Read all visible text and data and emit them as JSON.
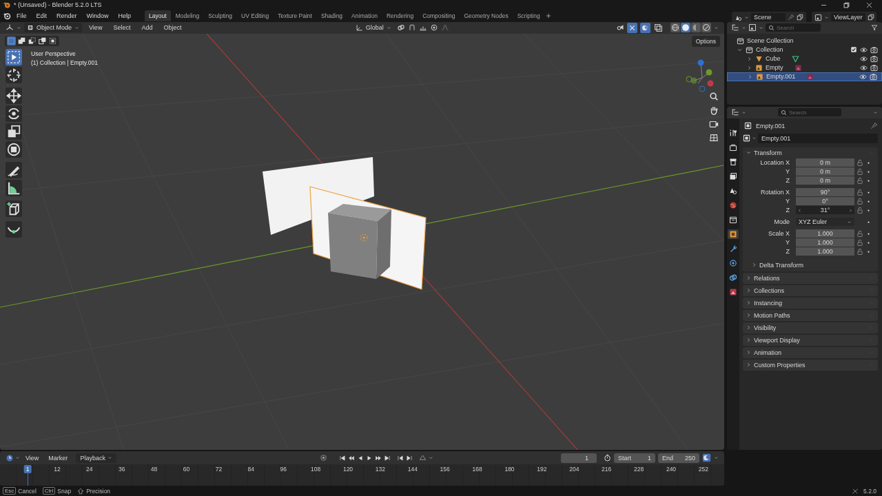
{
  "window": {
    "title": "* (Unsaved) - Blender 5.2.0 LTS"
  },
  "menu": [
    "File",
    "Edit",
    "Render",
    "Window",
    "Help"
  ],
  "workspaces": [
    {
      "label": "Layout",
      "selected": true
    },
    {
      "label": "Modeling",
      "selected": false
    },
    {
      "label": "Sculpting",
      "selected": false
    },
    {
      "label": "UV Editing",
      "selected": false
    },
    {
      "label": "Texture Paint",
      "selected": false
    },
    {
      "label": "Shading",
      "selected": false
    },
    {
      "label": "Animation",
      "selected": false
    },
    {
      "label": "Rendering",
      "selected": false
    },
    {
      "label": "Compositing",
      "selected": false
    },
    {
      "label": "Geometry Nodes",
      "selected": false
    },
    {
      "label": "Scripting",
      "selected": false
    }
  ],
  "scene_selector": {
    "scene": "Scene",
    "view_layer": "ViewLayer"
  },
  "viewport_header": {
    "mode": "Object Mode",
    "menus": [
      "View",
      "Select",
      "Add",
      "Object"
    ],
    "orientation": "Global",
    "toggles": [
      {
        "kind": "gizmo",
        "on": true
      },
      {
        "kind": "overlay",
        "on": true
      },
      {
        "kind": "xray",
        "on": false
      }
    ],
    "shading": [
      {
        "kind": "wireframe",
        "selected": false
      },
      {
        "kind": "solid",
        "selected": true
      },
      {
        "kind": "material",
        "selected": false
      },
      {
        "kind": "rendered",
        "selected": false
      }
    ]
  },
  "viewport": {
    "options": "Options",
    "overlay_lines": [
      "User Perspective",
      "(1) Collection | Empty.001"
    ],
    "select_modes": [
      {
        "kind": "new",
        "selected": true
      },
      {
        "kind": "extend",
        "selected": false
      },
      {
        "kind": "subtract",
        "selected": false
      },
      {
        "kind": "invert",
        "selected": false
      },
      {
        "kind": "intersect",
        "selected": false
      }
    ],
    "tools": [
      {
        "kind": "select",
        "selected": true
      },
      {
        "kind": "cursor",
        "selected": false
      },
      {
        "kind": "move",
        "selected": false
      },
      {
        "kind": "rotate",
        "selected": false
      },
      {
        "kind": "scale",
        "selected": false
      },
      {
        "kind": "transform",
        "selected": false
      },
      {
        "kind": "annotate",
        "selected": false
      },
      {
        "kind": "measure",
        "selected": false
      },
      {
        "kind": "add_cube",
        "selected": false
      },
      {
        "kind": "curve",
        "selected": false
      }
    ]
  },
  "outliner": {
    "search_placeholder": "Search",
    "root": "Scene Collection",
    "items": [
      {
        "label": "Collection",
        "kind": "collection",
        "expanded": true,
        "selected": false,
        "checked": true,
        "children": [
          {
            "label": "Cube",
            "kind": "mesh",
            "expanded": false,
            "selected": false
          },
          {
            "label": "Empty",
            "kind": "image_empty",
            "expanded": false,
            "selected": false
          },
          {
            "label": "Empty.001",
            "kind": "image_empty",
            "expanded": false,
            "selected": true
          }
        ]
      }
    ]
  },
  "properties": {
    "search_placeholder": "Search",
    "object_name": "Empty.001",
    "datablock": "Empty.001",
    "tabs": [
      {
        "kind": "tool",
        "selected": false
      },
      {
        "kind": "render",
        "selected": false
      },
      {
        "kind": "output",
        "selected": false
      },
      {
        "kind": "view_layer",
        "selected": false
      },
      {
        "kind": "scene",
        "selected": false
      },
      {
        "kind": "world",
        "selected": false
      },
      {
        "kind": "collection",
        "selected": false
      },
      {
        "kind": "object",
        "selected": true
      },
      {
        "kind": "modifiers",
        "selected": false
      },
      {
        "kind": "physics",
        "selected": false
      },
      {
        "kind": "constraints",
        "selected": false
      },
      {
        "kind": "data",
        "selected": false
      }
    ],
    "transform": {
      "title": "Transform",
      "expanded": true,
      "groups": [
        [
          {
            "label": "Location X",
            "value": "0 m",
            "kind": "number",
            "active": false
          },
          {
            "label": "Y",
            "value": "0 m",
            "kind": "number",
            "active": false
          },
          {
            "label": "Z",
            "value": "0 m",
            "kind": "number",
            "active": false
          }
        ],
        [
          {
            "label": "Rotation X",
            "value": "90°",
            "kind": "number",
            "active": false
          },
          {
            "label": "Y",
            "value": "0°",
            "kind": "number",
            "active": false
          },
          {
            "label": "Z",
            "value": "31°",
            "kind": "number",
            "active": true
          }
        ],
        [
          {
            "label": "Mode",
            "value": "XYZ Euler",
            "kind": "dropdown",
            "active": false
          }
        ],
        [
          {
            "label": "Scale X",
            "value": "1.000",
            "kind": "number",
            "active": false
          },
          {
            "label": "Y",
            "value": "1.000",
            "kind": "number",
            "active": false
          },
          {
            "label": "Z",
            "value": "1.000",
            "kind": "number",
            "active": false
          }
        ]
      ],
      "subpanels": [
        {
          "title": "Delta Transform",
          "expanded": false
        }
      ]
    },
    "panels": [
      {
        "title": "Relations",
        "expanded": false
      },
      {
        "title": "Collections",
        "expanded": false
      },
      {
        "title": "Instancing",
        "expanded": false
      },
      {
        "title": "Motion Paths",
        "expanded": false
      },
      {
        "title": "Visibility",
        "expanded": false
      },
      {
        "title": "Viewport Display",
        "expanded": false
      },
      {
        "title": "Animation",
        "expanded": false
      },
      {
        "title": "Custom Properties",
        "expanded": false
      }
    ]
  },
  "timeline": {
    "menus": [
      "View",
      "Marker",
      "Playback"
    ],
    "current_frame": "1",
    "start_label": "Start",
    "start": "1",
    "end_label": "End",
    "end": "250",
    "ruler": [
      {
        "label": "1",
        "selected": true
      },
      {
        "label": "12",
        "selected": false
      },
      {
        "label": "24",
        "selected": false
      },
      {
        "label": "36",
        "selected": false
      },
      {
        "label": "48",
        "selected": false
      },
      {
        "label": "60",
        "selected": false
      },
      {
        "label": "72",
        "selected": false
      },
      {
        "label": "84",
        "selected": false
      },
      {
        "label": "96",
        "selected": false
      },
      {
        "label": "108",
        "selected": false
      },
      {
        "label": "120",
        "selected": false
      },
      {
        "label": "132",
        "selected": false
      },
      {
        "label": "144",
        "selected": false
      },
      {
        "label": "156",
        "selected": false
      },
      {
        "label": "168",
        "selected": false
      },
      {
        "label": "180",
        "selected": false
      },
      {
        "label": "192",
        "selected": false
      },
      {
        "label": "204",
        "selected": false
      },
      {
        "label": "216",
        "selected": false
      },
      {
        "label": "228",
        "selected": false
      },
      {
        "label": "240",
        "selected": false
      },
      {
        "label": "252",
        "selected": false
      }
    ]
  },
  "status_bar": {
    "hints": [
      {
        "kind": "key",
        "key": "Esc",
        "action": "Cancel"
      },
      {
        "kind": "key",
        "key": "Ctrl",
        "action": "Snap"
      },
      {
        "kind": "icon",
        "action": "Precision"
      }
    ],
    "version": "5.2.0"
  }
}
